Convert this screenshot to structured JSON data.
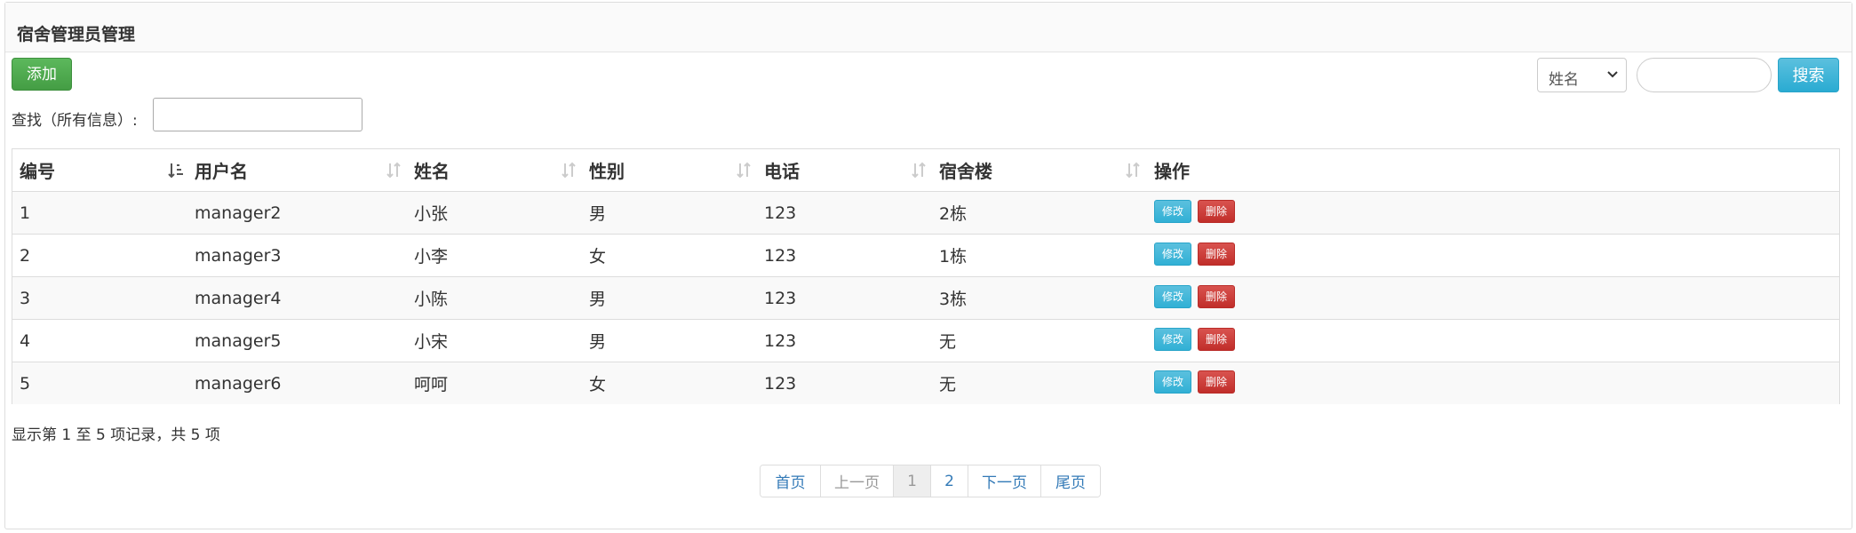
{
  "panel": {
    "title": "宿舍管理员管理"
  },
  "toolbar": {
    "add_label": "添加",
    "search_field_selected": "姓名",
    "search_input_value": "",
    "search_label": "搜索"
  },
  "filter": {
    "label": "查找（所有信息）:",
    "value": ""
  },
  "table": {
    "columns": [
      "编号",
      "用户名",
      "姓名",
      "性别",
      "电话",
      "宿舍楼",
      "操作"
    ],
    "rows": [
      {
        "id": "1",
        "username": "manager2",
        "name": "小张",
        "gender": "男",
        "phone": "123",
        "building": "2栋"
      },
      {
        "id": "2",
        "username": "manager3",
        "name": "小李",
        "gender": "女",
        "phone": "123",
        "building": "1栋"
      },
      {
        "id": "3",
        "username": "manager4",
        "name": "小陈",
        "gender": "男",
        "phone": "123",
        "building": "3栋"
      },
      {
        "id": "4",
        "username": "manager5",
        "name": "小宋",
        "gender": "男",
        "phone": "123",
        "building": "无"
      },
      {
        "id": "5",
        "username": "manager6",
        "name": "呵呵",
        "gender": "女",
        "phone": "123",
        "building": "无"
      }
    ],
    "edit_label": "修改",
    "delete_label": "删除",
    "sorted_column": "编号"
  },
  "info": "显示第 1 至 5 项记录，共 5 项",
  "pagination": {
    "first": "首页",
    "prev": "上一页",
    "pages": [
      "1",
      "2"
    ],
    "current": "1",
    "next": "下一页",
    "last": "尾页"
  },
  "colors": {
    "add": "#5cb85c",
    "search": "#5bc0de",
    "edit": "#5bc0de",
    "delete": "#d9534f",
    "link": "#337ab7"
  }
}
